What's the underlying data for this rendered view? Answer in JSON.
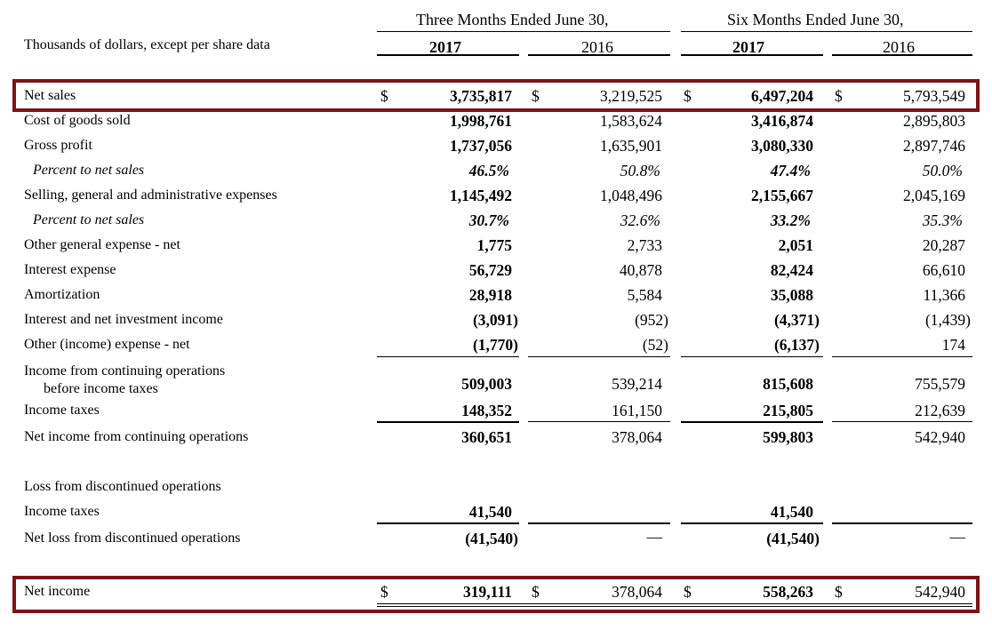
{
  "header": {
    "units_label": "Thousands of dollars, except per share data",
    "period_three": "Three Months Ended June 30,",
    "period_six": "Six Months Ended June 30,",
    "year_current": "2017",
    "year_prior": "2016"
  },
  "currency_symbol": "$",
  "dash": "—",
  "rows": [
    {
      "label": "Net sales",
      "values": [
        "3,735,817",
        "3,219,525",
        "6,497,204",
        "5,793,549"
      ]
    },
    {
      "label": "Cost of goods sold",
      "values": [
        "1,998,761",
        "1,583,624",
        "3,416,874",
        "2,895,803"
      ]
    },
    {
      "label": "Gross profit",
      "values": [
        "1,737,056",
        "1,635,901",
        "3,080,330",
        "2,897,746"
      ]
    },
    {
      "label": "Percent to net sales",
      "values": [
        "46.5%",
        "50.8%",
        "47.4%",
        "50.0%"
      ]
    },
    {
      "label": "Selling, general and administrative expenses",
      "values": [
        "1,145,492",
        "1,048,496",
        "2,155,667",
        "2,045,169"
      ]
    },
    {
      "label": "Percent to net sales",
      "values": [
        "30.7%",
        "32.6%",
        "33.2%",
        "35.3%"
      ]
    },
    {
      "label": "Other general expense - net",
      "values": [
        "1,775",
        "2,733",
        "2,051",
        "20,287"
      ]
    },
    {
      "label": "Interest expense",
      "values": [
        "56,729",
        "40,878",
        "82,424",
        "66,610"
      ]
    },
    {
      "label": "Amortization",
      "values": [
        "28,918",
        "5,584",
        "35,088",
        "11,366"
      ]
    },
    {
      "label": "Interest and net investment income",
      "values": [
        "(3,091)",
        "(952)",
        "(4,371)",
        "(1,439)"
      ]
    },
    {
      "label": "Other (income) expense - net",
      "values": [
        "(1,770)",
        "(52)",
        "(6,137)",
        "174"
      ]
    },
    {
      "label_line1": "Income from continuing operations",
      "label_line2": "before income taxes",
      "values": [
        "509,003",
        "539,214",
        "815,608",
        "755,579"
      ]
    },
    {
      "label": "Income taxes",
      "values": [
        "148,352",
        "161,150",
        "215,805",
        "212,639"
      ]
    },
    {
      "label": "Net income from continuing operations",
      "values": [
        "360,651",
        "378,064",
        "599,803",
        "542,940"
      ]
    },
    {
      "label": "Loss from discontinued operations",
      "values": []
    },
    {
      "label": "Income taxes",
      "values": [
        "41,540",
        "",
        "41,540",
        ""
      ]
    },
    {
      "label": "Net loss from discontinued operations",
      "values": [
        "(41,540)",
        "",
        "(41,540)",
        ""
      ]
    },
    {
      "label": "Net income",
      "values": [
        "319,111",
        "378,064",
        "558,263",
        "542,940"
      ]
    }
  ],
  "highlight_color": "#7b1416"
}
